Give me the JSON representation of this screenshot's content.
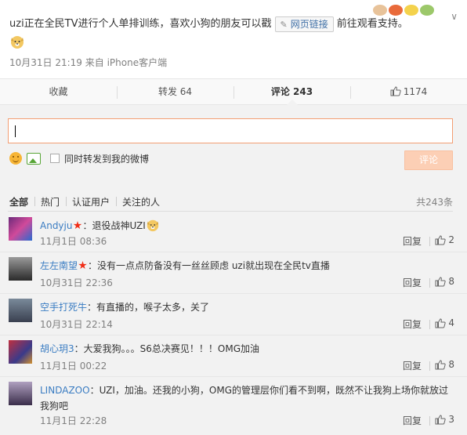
{
  "post": {
    "text_before": "uzi正在全民TV进行个人单排训练，喜欢小狗的朋友可以戳",
    "link_label": "网页链接",
    "text_after": "前往观看支持。",
    "meta": "10月31日 21:19 来自 iPhone客户端",
    "emoji_icons": [
      "bear-emoji-icon",
      "food-emoji-icon",
      "smile-emoji-icon",
      "doge-emoji-icon"
    ]
  },
  "actions": {
    "favorite": "收藏",
    "repost": "转发 64",
    "comment": "评论 243",
    "like": "1174"
  },
  "composer": {
    "input_value": "",
    "repost_label": "同时转发到我的微博",
    "submit_label": "评论"
  },
  "filters": {
    "tabs": [
      "全部",
      "热门",
      "认证用户",
      "关注的人"
    ],
    "total": "共243条"
  },
  "comments": [
    {
      "name": "Andyju",
      "vip": true,
      "text": "：退役战神UZI",
      "doge": true,
      "time": "11月1日 08:36",
      "reply": "回复",
      "likes": "2",
      "avatar": "#6c2a7a"
    },
    {
      "name": "左左南望",
      "vip": true,
      "text": "：没有一点点防备没有一丝丝顾虑 uzi就出现在全民tv直播",
      "doge": false,
      "time": "10月31日 22:36",
      "reply": "回复",
      "likes": "8",
      "avatar": "#3b3b3b"
    },
    {
      "name": "空手打死牛",
      "vip": false,
      "text": "：有直播的，喉子太多，关了",
      "doge": false,
      "time": "10月31日 22:14",
      "reply": "回复",
      "likes": "4",
      "avatar": "#4a5a6a"
    },
    {
      "name": "胡心玥3",
      "vip": false,
      "text": "：大爱我狗。。。S6总决赛见！！！OMG加油",
      "doge": false,
      "time": "11月1日 00:22",
      "reply": "回复",
      "likes": "8",
      "avatar": "#7a3340"
    },
    {
      "name": "LINDAZOO",
      "vip": false,
      "text": "：UZI，加油。还我的小狗，OMG的管理层你们看不到啊，既然不让我狗上场你就放过我狗吧",
      "doge": false,
      "time": "11月1日 22:28",
      "reply": "回复",
      "likes": "3",
      "avatar": "#5a4e66"
    }
  ]
}
